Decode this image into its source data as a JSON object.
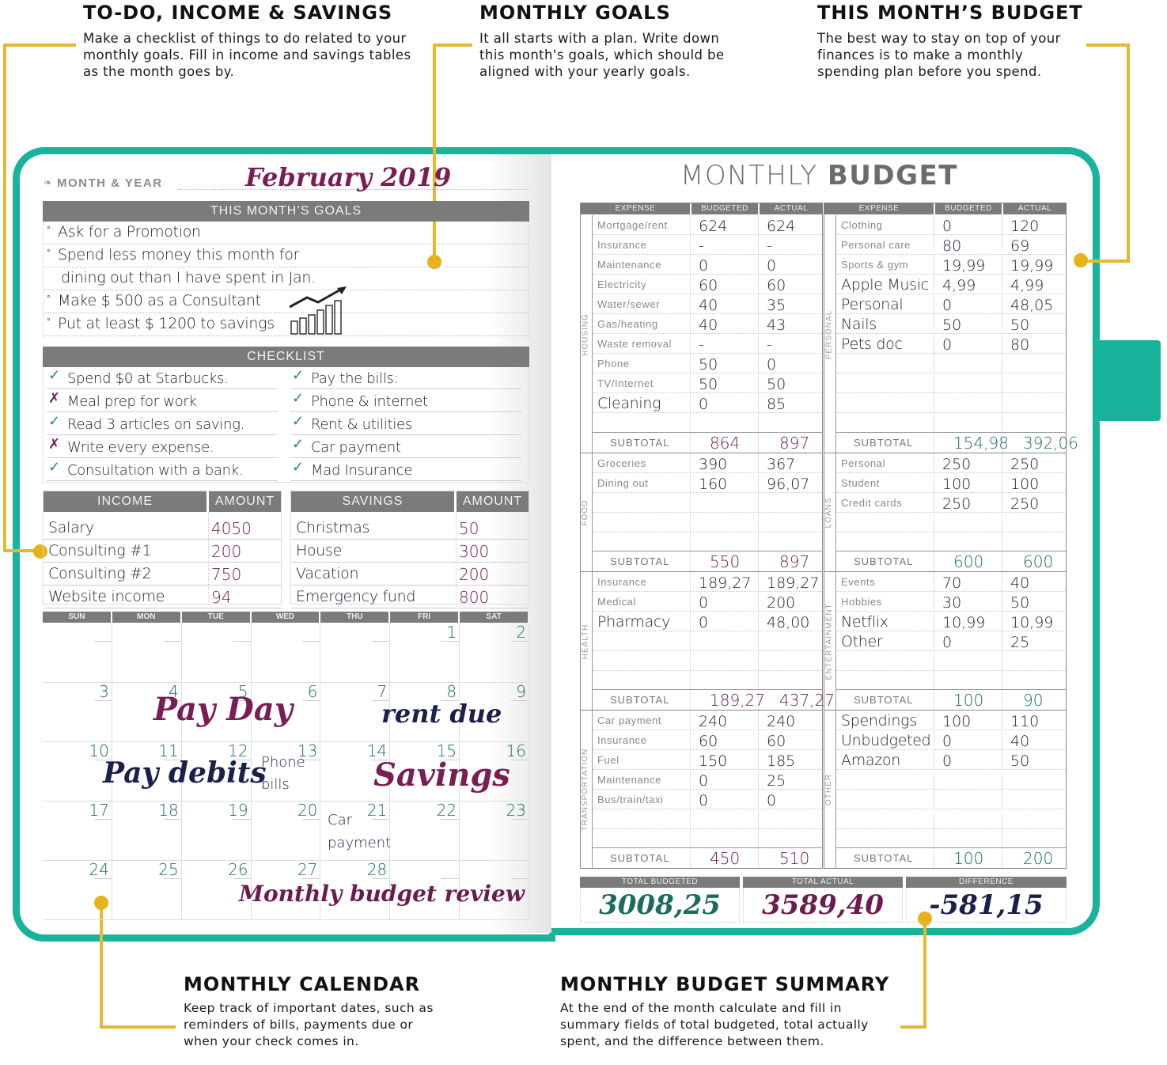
{
  "callouts": {
    "todo": {
      "title": "TO-DO, INCOME & SAVINGS",
      "body": "Make a checklist of things to do related to your monthly goals. Fill in income and savings tables as the month goes by."
    },
    "goals": {
      "title": "MONTHLY GOALS",
      "body": "It all starts with a plan. Write down this month's goals, which should be aligned with your yearly goals."
    },
    "budget": {
      "title": "THIS MONTH’S BUDGET",
      "body": "The best way to stay on top of your finances is to make a monthly spending plan before you spend."
    },
    "calendar": {
      "title": "MONTHLY CALENDAR",
      "body": "Keep track of important dates, such as reminders of bills, payments due or when your check comes in."
    },
    "summary": {
      "title": "MONTHLY BUDGET SUMMARY",
      "body": "At the end of the month calculate and fill in summary fields of total budgeted, total actually spent, and the difference between them."
    }
  },
  "colors": {
    "cover": "#17b49b",
    "callout_line": "#e6b82e",
    "header_gray": "#7b7b7b",
    "ink_purple": "#6b1c4c",
    "ink_teal": "#1a6b60",
    "ink_navy": "#1b1f4a"
  },
  "left_page": {
    "month_label": "MONTH & YEAR",
    "month_value": "February 2019",
    "goals_header": "THIS MONTH’S GOALS",
    "goals": [
      "Ask for a Promotion",
      "Spend less money this month for",
      "dining out than I have spent in Jan.",
      "Make $ 500 as a Consultant",
      "Put at least $ 1200 to savings"
    ],
    "checklist_header": "CHECKLIST",
    "checklist_left": [
      {
        "text": "Spend $0 at Starbucks.",
        "status": "check"
      },
      {
        "text": "Meal prep for work",
        "status": "cross"
      },
      {
        "text": "Read 3 articles on saving.",
        "status": "check"
      },
      {
        "text": "Write every expense.",
        "status": "cross"
      },
      {
        "text": "Consultation with a bank.",
        "status": "check"
      }
    ],
    "checklist_right": [
      {
        "text": "Pay the bills:",
        "status": "check"
      },
      {
        "text": "Phone & internet",
        "status": "check"
      },
      {
        "text": "Rent & utilities",
        "status": "check"
      },
      {
        "text": "Car  payment",
        "status": "check"
      },
      {
        "text": "Mad Insurance",
        "status": "check"
      }
    ],
    "income": {
      "header": "INCOME",
      "amount_header": "AMOUNT",
      "rows": [
        {
          "label": "Salary",
          "amount": "4050"
        },
        {
          "label": "Consulting #1",
          "amount": "200"
        },
        {
          "label": "Consulting #2",
          "amount": "750"
        },
        {
          "label": "Website income",
          "amount": "94"
        }
      ]
    },
    "savings": {
      "header": "SAVINGS",
      "amount_header": "AMOUNT",
      "rows": [
        {
          "label": "Christmas",
          "amount": "50"
        },
        {
          "label": "House",
          "amount": "300"
        },
        {
          "label": "Vacation",
          "amount": "200"
        },
        {
          "label": "Emergency fund",
          "amount": "800"
        }
      ]
    },
    "calendar": {
      "days": [
        "SUN",
        "MON",
        "TUE",
        "WED",
        "THU",
        "FRI",
        "SAT"
      ],
      "weeks": [
        [
          "",
          "",
          "",
          "",
          "",
          "1",
          "2"
        ],
        [
          "3",
          "4",
          "5",
          "6",
          "7",
          "8",
          "9"
        ],
        [
          "10",
          "11",
          "12",
          "13",
          "14",
          "15",
          "16"
        ],
        [
          "17",
          "18",
          "19",
          "20",
          "21",
          "22",
          "23"
        ],
        [
          "24",
          "25",
          "26",
          "27",
          "28",
          "",
          ""
        ]
      ],
      "notes": {
        "pay_day": "Pay Day",
        "rent_due": "rent due",
        "pay_debits": "Pay debits",
        "phone": "Phone",
        "bills": "bills",
        "savings": "Savings",
        "car": "Car",
        "payment": "payment",
        "review": "Monthly budget review"
      }
    }
  },
  "right_page": {
    "title_light": "MONTHLY ",
    "title_bold": "BUDGET",
    "col_headers": {
      "expense": "EXPENSE",
      "budgeted": "BUDGETED",
      "actual": "ACTUAL"
    },
    "subtotal_label": "SUBTOTAL",
    "left_sections": [
      {
        "name": "HOUSING",
        "rows": [
          [
            "Mortgage/rent",
            "624",
            "624"
          ],
          [
            "Insurance",
            "-",
            "-"
          ],
          [
            "Maintenance",
            "0",
            "0"
          ],
          [
            "Electricity",
            "60",
            "60"
          ],
          [
            "Water/sewer",
            "40",
            "35"
          ],
          [
            "Gas/heating",
            "40",
            "43"
          ],
          [
            "Waste removal",
            "-",
            "-"
          ],
          [
            "Phone",
            "50",
            "0"
          ],
          [
            "TV/Internet",
            "50",
            "50"
          ],
          [
            "Cleaning",
            "0",
            "85"
          ]
        ],
        "subtotal": [
          "864",
          "897"
        ]
      },
      {
        "name": "FOOD",
        "rows": [
          [
            "Groceries",
            "390",
            "367"
          ],
          [
            "Dining out",
            "160",
            "96,07"
          ]
        ],
        "subtotal": [
          "550",
          "897"
        ]
      },
      {
        "name": "HEALTH",
        "rows": [
          [
            "Insurance",
            "189,27",
            "189,27"
          ],
          [
            "Medical",
            "0",
            "200"
          ],
          [
            "Pharmacy",
            "0",
            "48,00"
          ]
        ],
        "subtotal": [
          "189,27",
          "437,27"
        ]
      },
      {
        "name": "TRANSPORTATION",
        "rows": [
          [
            "Car payment",
            "240",
            "240"
          ],
          [
            "Insurance",
            "60",
            "60"
          ],
          [
            "Fuel",
            "150",
            "185"
          ],
          [
            "Maintenance",
            "0",
            "25"
          ],
          [
            "Bus/train/taxi",
            "0",
            "0"
          ]
        ],
        "subtotal": [
          "450",
          "510"
        ]
      }
    ],
    "right_sections": [
      {
        "name": "PERSONAL",
        "rows": [
          [
            "Clothing",
            "0",
            "120"
          ],
          [
            "Personal care",
            "80",
            "69"
          ],
          [
            "Sports & gym",
            "19,99",
            "19,99"
          ],
          [
            "Apple Music",
            "4,99",
            "4,99"
          ],
          [
            "Personal",
            "0",
            "48,05"
          ],
          [
            "Nails",
            "50",
            "50"
          ],
          [
            "Pets doc",
            "0",
            "80"
          ]
        ],
        "subtotal": [
          "154,98",
          "392,06"
        ]
      },
      {
        "name": "LOANS",
        "rows": [
          [
            "Personal",
            "250",
            "250"
          ],
          [
            "Student",
            "100",
            "100"
          ],
          [
            "Credit cards",
            "250",
            "250"
          ]
        ],
        "subtotal": [
          "600",
          "600"
        ]
      },
      {
        "name": "ENTERTAINMENT",
        "rows": [
          [
            "Events",
            "70",
            "40"
          ],
          [
            "Hobbies",
            "30",
            "50"
          ],
          [
            "Netflix",
            "10,99",
            "10,99"
          ],
          [
            "Other",
            "0",
            "25"
          ]
        ],
        "subtotal": [
          "100",
          "90"
        ]
      },
      {
        "name": "OTHER",
        "rows": [
          [
            "Spendings",
            "100",
            "110"
          ],
          [
            "Unbudgeted",
            "0",
            "40"
          ],
          [
            "Amazon",
            "0",
            "50"
          ]
        ],
        "subtotal": [
          "100",
          "200"
        ]
      }
    ],
    "summary": {
      "total_budgeted_label": "TOTAL BUDGETED",
      "total_budgeted": "3008,25",
      "total_actual_label": "TOTAL ACTUAL",
      "total_actual": "3589,40",
      "difference_label": "DIFFERENCE",
      "difference": "-581,15"
    }
  }
}
